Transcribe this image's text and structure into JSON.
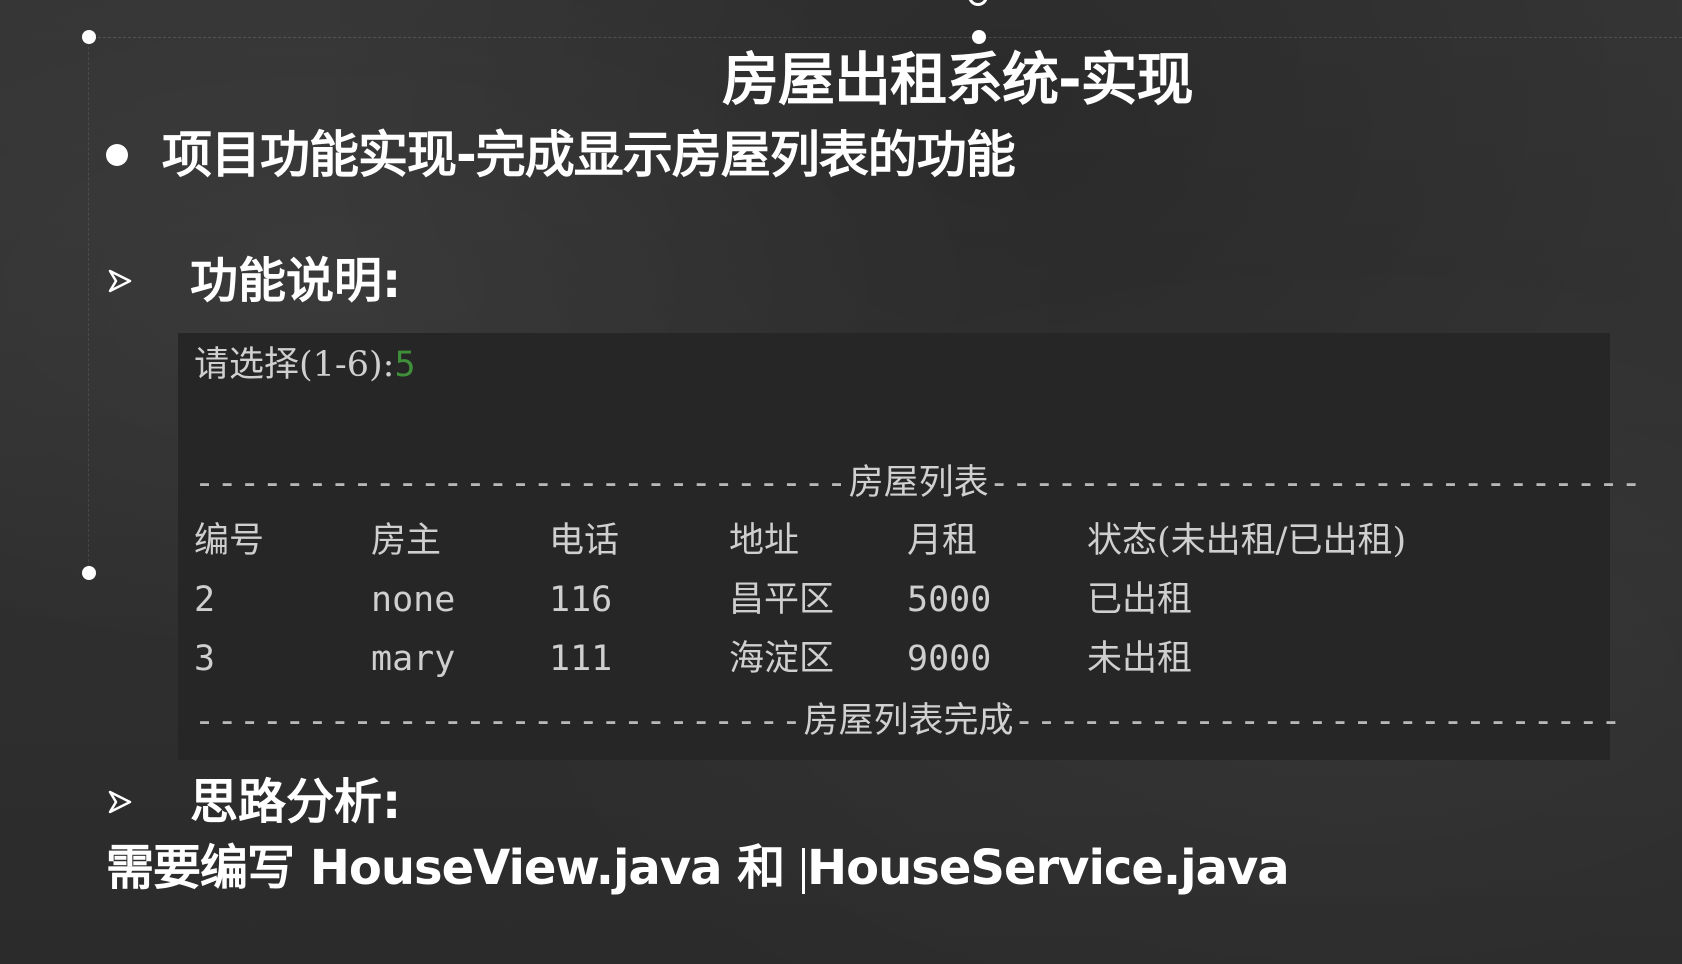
{
  "slide": {
    "title": "房屋出租系统-实现",
    "bullet": "项目功能实现-完成显示房屋列表的功能",
    "section_1": "功能说明:",
    "section_2": "思路分析:",
    "footer_before_cursor": "需要编写 HouseView.java 和 ",
    "footer_after_cursor": "HouseService.java"
  },
  "console": {
    "prompt_label": "请选择(1-6):",
    "prompt_value": "5",
    "list_header_left_dashes": "-----------------------------",
    "list_header_label": "房屋列表",
    "list_header_right_dashes": "-----------------------------",
    "list_footer_left_dashes": "---------------------------",
    "list_footer_label": "房屋列表完成",
    "list_footer_right_dashes": "---------------------------",
    "columns": [
      "编号",
      "房主",
      "电话",
      "地址",
      "月租",
      "状态(未出租/已出租)"
    ],
    "rows": [
      [
        "2",
        "none",
        "116",
        "昌平区",
        "5000",
        "已出租"
      ],
      [
        "3",
        "mary",
        "111",
        "海淀区",
        "9000",
        "未出租"
      ]
    ]
  },
  "colors": {
    "background": "#2f2f2f",
    "console_background": "#262626",
    "prompt_value": "#3f8f3a",
    "text": "#ffffff",
    "console_text": "#cfcfcf"
  }
}
